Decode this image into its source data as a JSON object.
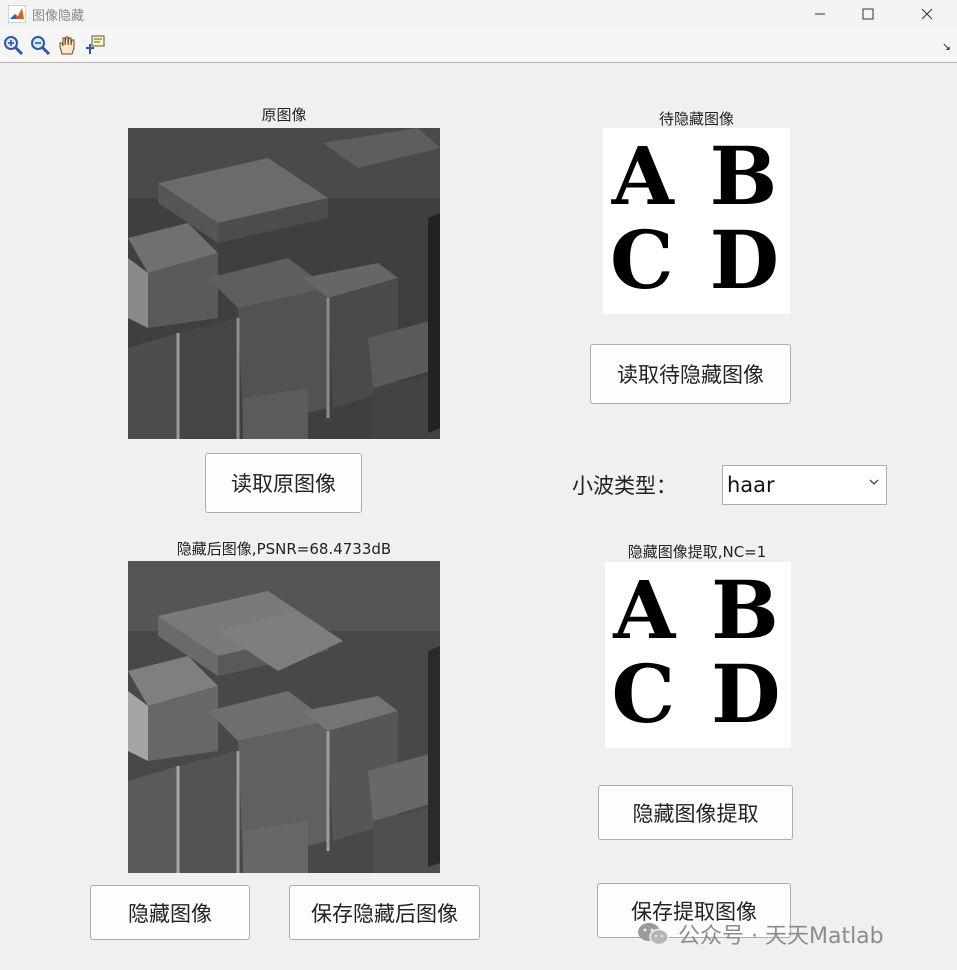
{
  "window": {
    "title": "图像隐藏"
  },
  "toolbar": {
    "tools": [
      "zoom-in-icon",
      "zoom-out-icon",
      "pan-hand-icon",
      "data-cursor-icon"
    ]
  },
  "panels": {
    "original_title": "原图像",
    "secret_title": "待隐藏图像",
    "stego_title": "隐藏后图像,PSNR=68.4733dB",
    "extracted_title": "隐藏图像提取,NC=1"
  },
  "secret_letters": {
    "row1": "A B",
    "row2": "C D"
  },
  "buttons": {
    "read_secret": "读取待隐藏图像",
    "read_original": "读取原图像",
    "hide_image": "隐藏图像",
    "save_stego": "保存隐藏后图像",
    "extract": "隐藏图像提取",
    "save_extracted": "保存提取图像"
  },
  "wavelet": {
    "label": "小波类型：",
    "selected": "haar"
  },
  "watermark": {
    "text": "公众号 · 天天Matlab"
  },
  "colors": {
    "background": "#f0f0f0",
    "button_border": "#adadad",
    "text": "#222222"
  }
}
